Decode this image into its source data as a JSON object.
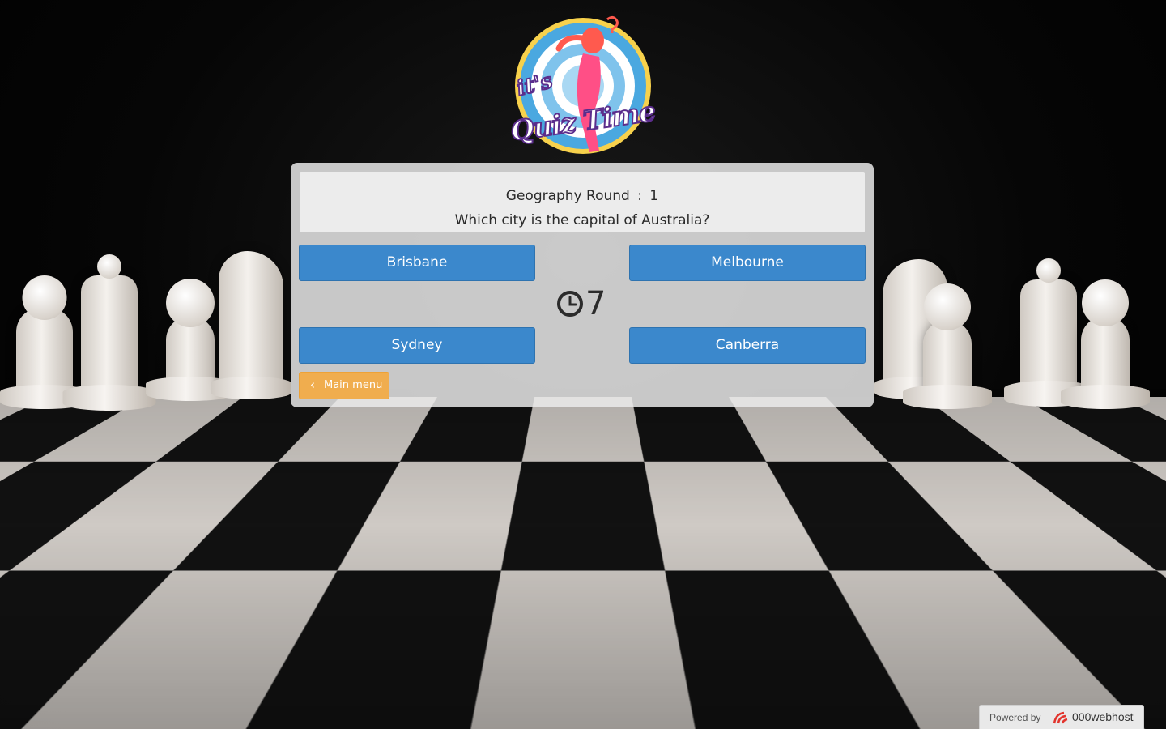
{
  "logo": {
    "line1": "it's",
    "line2": "Quiz Time"
  },
  "quiz": {
    "round_label": "Geography Round",
    "round_separator": ":",
    "round_number": "1",
    "question": "Which city is the capital of Australia?",
    "answers": [
      "Brisbane",
      "Melbourne",
      "Sydney",
      "Canberra"
    ],
    "timer_value": "7",
    "main_menu_label": "Main menu"
  },
  "footer": {
    "powered_by": "Powered by",
    "brand": "000webhost"
  },
  "colors": {
    "answer_button": "#3b88cc",
    "menu_button": "#f0ad4e",
    "panel": "#ececec"
  },
  "icons": {
    "timer": "clock-icon",
    "menu_back": "chevron-left-icon",
    "host_logo": "000webhost-logo-icon"
  }
}
